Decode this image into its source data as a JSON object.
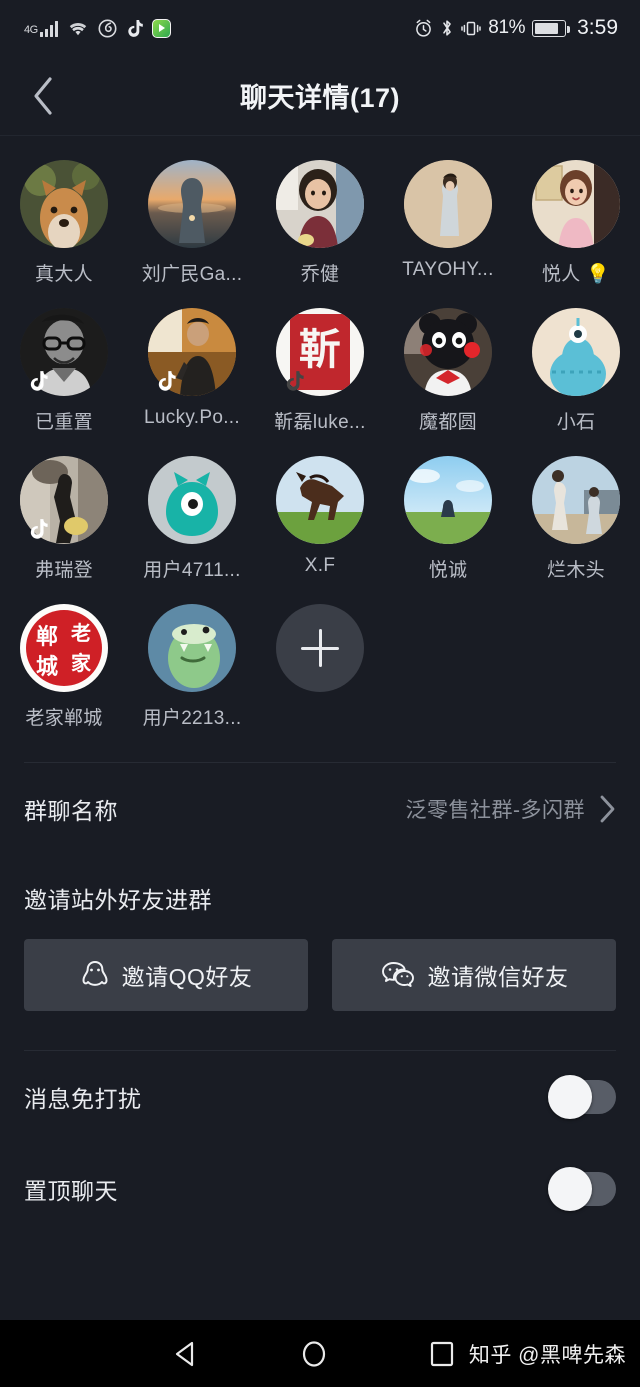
{
  "status_bar": {
    "network_type": "4G",
    "icons": [
      "signal-bars-icon",
      "wifi-icon",
      "netease-music-icon",
      "tiktok-icon",
      "video-app-icon",
      "alarm-icon",
      "bluetooth-icon",
      "vibrate-icon"
    ],
    "battery_percent": "81%",
    "time": "3:59"
  },
  "header": {
    "back_icon": "chevron-left-icon",
    "title": "聊天详情(17)"
  },
  "members": [
    {
      "name": "真大人",
      "avatar": "dog-photo",
      "tiktok_badge": false
    },
    {
      "name": "刘广民Ga...",
      "avatar": "sunset-silhouette",
      "tiktok_badge": false
    },
    {
      "name": "乔健",
      "avatar": "woman-photo",
      "tiktok_badge": false
    },
    {
      "name": "TAYOHY...",
      "avatar": "beige-portrait",
      "tiktok_badge": false
    },
    {
      "name": "悦人 💡",
      "avatar": "retro-lady",
      "tiktok_badge": false
    },
    {
      "name": "已重置",
      "avatar": "bw-man-glasses",
      "tiktok_badge": true
    },
    {
      "name": "Lucky.Po...",
      "avatar": "speaker-stage",
      "tiktok_badge": true
    },
    {
      "name": "靳磊luke...",
      "avatar": "red-seal",
      "tiktok_badge": true
    },
    {
      "name": "魔都圆",
      "avatar": "kumamon-bear",
      "tiktok_badge": false
    },
    {
      "name": "小石",
      "avatar": "blue-creature",
      "tiktok_badge": false
    },
    {
      "name": "弗瑞登",
      "avatar": "street-walk",
      "tiktok_badge": true
    },
    {
      "name": "用户4711...",
      "avatar": "teal-monster",
      "tiktok_badge": false
    },
    {
      "name": "X.F",
      "avatar": "brown-horse",
      "tiktok_badge": false
    },
    {
      "name": "悦诚",
      "avatar": "field-sky",
      "tiktok_badge": false
    },
    {
      "name": "烂木头",
      "avatar": "beach-couple",
      "tiktok_badge": false
    },
    {
      "name": "老家郸城",
      "avatar": "red-seal-square",
      "tiktok_badge": false
    },
    {
      "name": "用户2213...",
      "avatar": "green-frog",
      "tiktok_badge": false
    }
  ],
  "add_member": {
    "icon": "plus-icon",
    "label": ""
  },
  "group_name_row": {
    "label": "群聊名称",
    "value": "泛零售社群-多闪群",
    "chevron": "chevron-right-icon"
  },
  "invite_section": {
    "title": "邀请站外好友进群",
    "buttons": [
      {
        "label": "邀请QQ好友",
        "icon": "qq-penguin-icon"
      },
      {
        "label": "邀请微信好友",
        "icon": "wechat-icon"
      }
    ]
  },
  "settings": [
    {
      "label": "消息免打扰",
      "enabled": false
    },
    {
      "label": "置顶聊天",
      "enabled": false
    }
  ],
  "nav_bar": {
    "back": "triangle-back-icon",
    "home": "circle-home-icon",
    "recents": "square-recents-icon",
    "watermark": "知乎 @黑啤先森"
  },
  "colors": {
    "background": "#191c24",
    "surface": "#3a3e47",
    "text_primary": "#e9ebef",
    "text_secondary": "#8d929c",
    "divider": "#272b34",
    "toggle_track": "#585d67",
    "toggle_knob": "#f4f5f7"
  }
}
